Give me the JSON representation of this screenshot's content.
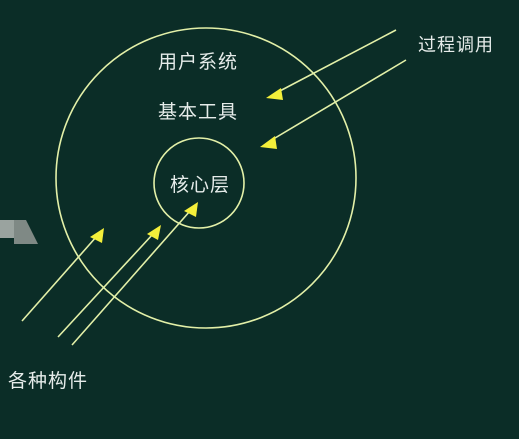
{
  "diagram": {
    "outer_ring_label": "用户系统",
    "middle_ring_label": "基本工具",
    "core_label": "核心层",
    "process_call_label": "过程调用",
    "components_label": "各种构件"
  },
  "colors": {
    "background": "#0b2d27",
    "ring_stroke": "#e3f0a8",
    "arrow_line": "#e3f0a8",
    "arrow_head": "#f4ef3a",
    "text": "#e6ecea"
  }
}
